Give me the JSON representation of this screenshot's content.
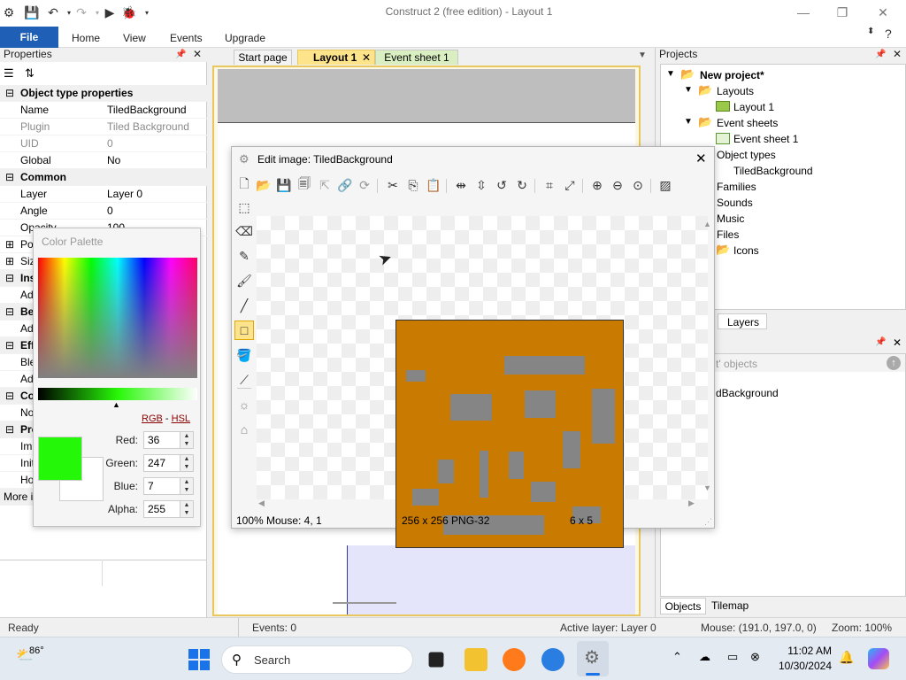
{
  "window": {
    "title": "Construct 2  (free edition) - Layout 1"
  },
  "ribbon": {
    "tabs": [
      "File",
      "Home",
      "View",
      "Events",
      "Upgrade"
    ]
  },
  "properties": {
    "title": "Properties",
    "group_object_type": "Object type properties",
    "rows_a": [
      {
        "label": "Name",
        "value": "TiledBackground"
      },
      {
        "label": "Plugin",
        "value": "Tiled Background"
      },
      {
        "label": "UID",
        "value": "0"
      },
      {
        "label": "Global",
        "value": "No"
      }
    ],
    "group_common": "Common",
    "rows_b": [
      {
        "label": "Layer",
        "value": "Layer 0"
      },
      {
        "label": "Angle",
        "value": "0"
      },
      {
        "label": "Opacity",
        "value": "100"
      }
    ],
    "partial_labels": [
      "Po",
      "Siz",
      "Ins",
      "Ad",
      "Be",
      "Ad",
      "Eff",
      "Ble",
      "Ad",
      "Co",
      "No",
      "Pro",
      "Im",
      "Init",
      "Ho",
      "More i"
    ]
  },
  "doc_tabs": [
    "Start page",
    "Layout 1",
    "Event sheet 1"
  ],
  "dialog": {
    "title": "Edit image: TiledBackground",
    "status_zoom": "100%",
    "status_mouse": "Mouse: 4, 1",
    "status_size": "256 x 256  PNG-32",
    "status_grid": "6 x 5"
  },
  "palette": {
    "title": "Color Palette",
    "mode_rgb": "RGB",
    "mode_sep": " - ",
    "mode_hsl": "HSL",
    "red_label": "Red:",
    "red": "36",
    "green_label": "Green:",
    "green": "247",
    "blue_label": "Blue:",
    "blue": "7",
    "alpha_label": "Alpha:",
    "alpha": "255",
    "color": "#24f707"
  },
  "projects": {
    "title": "Projects",
    "root": "New project*",
    "layouts": "Layouts",
    "layout1": "Layout 1",
    "event_sheets": "Event sheets",
    "event_sheet1": "Event sheet 1",
    "object_types": "Object types",
    "tiled_bg": "TiledBackground",
    "families": "Families",
    "sounds": "Sounds",
    "music": "Music",
    "files": "Files",
    "icons": "Icons",
    "layers_tab": "Layers"
  },
  "objects_panel": {
    "header_partial": "t' objects",
    "item_partial": "dBackground",
    "tab_objects": "Objects",
    "tab_tilemap": "Tilemap"
  },
  "statusbar": {
    "ready": "Ready",
    "events": "Events: 0",
    "active_layer": "Active layer: Layer 0",
    "mouse": "Mouse: (191.0, 197.0, 0)",
    "zoom": "Zoom: 100%"
  },
  "taskbar": {
    "weather_temp": "86°",
    "search_placeholder": "Search",
    "time": "11:02 AM",
    "date": "10/30/2024"
  }
}
